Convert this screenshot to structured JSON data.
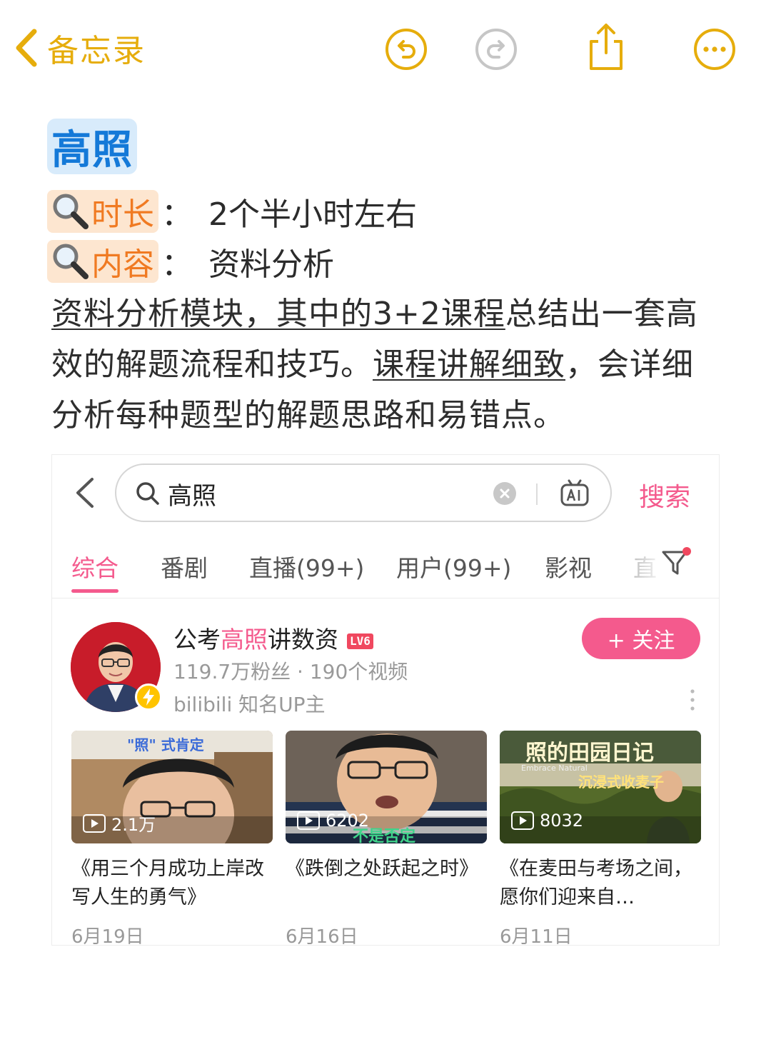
{
  "header": {
    "back_label": "备忘录"
  },
  "note": {
    "title": "高照",
    "duration_key": "时长",
    "duration_value": "2个半小时左右",
    "content_key": "内容",
    "content_value": "资料分析",
    "colon": "：",
    "magnifier_icon": "🔍",
    "paragraph": {
      "part1_underlined": "资料分析模块，其中的3+2课程",
      "part2": "总结出一套高效的解题流程和技巧。",
      "part3_underlined": "课程讲解细致",
      "part4": "，会详细分析每种题型的解题思路和易错点。"
    }
  },
  "embedded": {
    "search": {
      "query": "高照",
      "button": "搜索"
    },
    "tabs": [
      "综合",
      "番剧",
      "直播(99+)",
      "用户(99+)",
      "影视",
      "直"
    ],
    "active_tab": 0,
    "uploader": {
      "name_prefix": "公考",
      "name_highlight": "高照",
      "name_suffix": "讲数资",
      "level": "LV6",
      "stats": "119.7万粉丝 · 190个视频",
      "role": "bilibili 知名UP主",
      "follow": "+ 关注"
    },
    "videos": [
      {
        "plays": "2.1万",
        "title": "《用三个月成功上岸改写人生的勇气》",
        "date": "6月19日",
        "overlay": "\"照\" 式肯定"
      },
      {
        "plays": "6202",
        "title": "《跌倒之处跃起之时》",
        "date": "6月16日",
        "overlay": "不是否定"
      },
      {
        "plays": "8032",
        "title": "《在麦田与考场之间，愿你们迎来自…",
        "date": "6月11日",
        "overlay": "照的田园日记",
        "overlay2": "沉浸式收麦子",
        "overlay3": "Embrace Natural"
      }
    ]
  },
  "colors": {
    "notes_yellow": "#e6ad0c",
    "title_blue": "#1479d8",
    "title_bg": "#d8ebfb",
    "tag_orange": "#f07a22",
    "tag_bg": "#fde6d0",
    "bilibili_pink": "#f45a8d"
  }
}
